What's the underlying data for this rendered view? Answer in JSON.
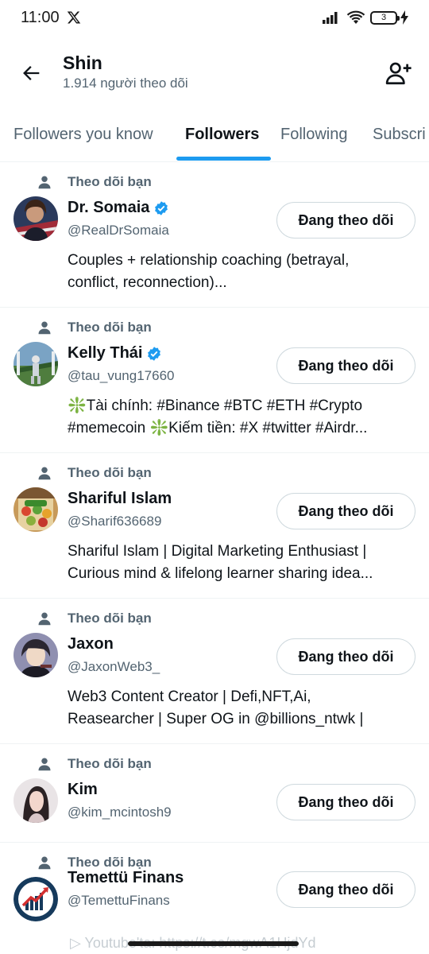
{
  "status_bar": {
    "time": "11:00",
    "battery": "3"
  },
  "header": {
    "title": "Shin",
    "subtitle": "1.914 người theo dõi"
  },
  "tabs": [
    {
      "label": "Followers you know"
    },
    {
      "label": "Followers"
    },
    {
      "label": "Following"
    },
    {
      "label": "Subscri"
    }
  ],
  "follows_you_label": "Theo dõi bạn",
  "follow_button_label": "Đang theo dõi",
  "users": [
    {
      "name": "Dr. Somaia",
      "handle": "@RealDrSomaia",
      "verified": true,
      "bio": [
        "Couples + relationship coaching (betrayal,",
        "conflict, reconnection)..."
      ]
    },
    {
      "name": "Kelly Thái",
      "handle": "@tau_vung17660",
      "verified": true,
      "bio": [
        "❇️Tài chính: #Binance #BTC #ETH #Crypto",
        "#memecoin ❇️Kiếm tiền: #X #twitter #Airdr..."
      ]
    },
    {
      "name": "Shariful Islam",
      "handle": "@Sharif636689",
      "verified": false,
      "bio": [
        "Shariful Islam | Digital Marketing Enthusiast |",
        "Curious mind & lifelong learner sharing idea..."
      ]
    },
    {
      "name": "Jaxon",
      "handle": "@JaxonWeb3_",
      "verified": false,
      "bio": [
        "Web3 Content Creator | Defi,NFT,Ai,",
        "Reasearcher | Super OG in @billions_ntwk |"
      ]
    },
    {
      "name": "Kim",
      "handle": "@kim_mcintosh9",
      "verified": false,
      "bio": []
    },
    {
      "name": "Temettü Finans",
      "handle": "@TemettuFinans",
      "verified": false,
      "bio": []
    }
  ],
  "footer_partial": "▷ Youtube'ta: https://t.co/mgwA1HjdYd",
  "colors": {
    "accent": "#1d9bf0",
    "text": "#0f1419",
    "secondary": "#536471",
    "border": "#cfd9de"
  }
}
